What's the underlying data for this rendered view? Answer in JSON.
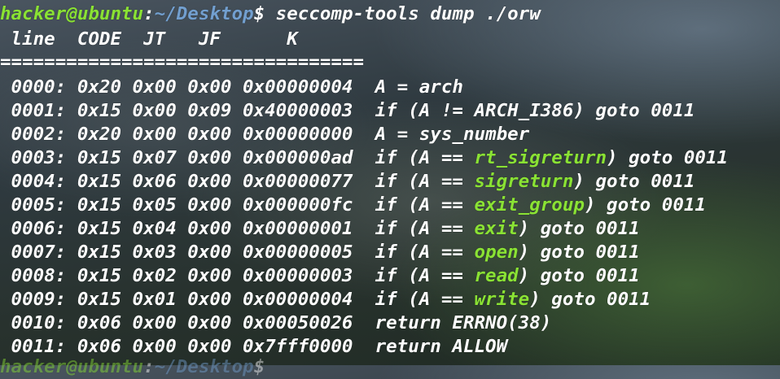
{
  "prompt": {
    "user_host": "hacker@ubuntu",
    "colon": ":",
    "path": "~/Desktop",
    "dollar": "$",
    "command": " seccomp-tools dump ./orw"
  },
  "header": {
    "columns": " line  CODE  JT   JF      K",
    "separator": "================================="
  },
  "rows": [
    {
      "prefix": " 0000: 0x20 0x00 0x00 0x00000004  A = arch",
      "syscall": "",
      "suffix": ""
    },
    {
      "prefix": " 0001: 0x15 0x00 0x09 0x40000003  if (A != ARCH_I386) goto 0011",
      "syscall": "",
      "suffix": ""
    },
    {
      "prefix": " 0002: 0x20 0x00 0x00 0x00000000  A = sys_number",
      "syscall": "",
      "suffix": ""
    },
    {
      "prefix": " 0003: 0x15 0x07 0x00 0x000000ad  if (A == ",
      "syscall": "rt_sigreturn",
      "suffix": ") goto 0011"
    },
    {
      "prefix": " 0004: 0x15 0x06 0x00 0x00000077  if (A == ",
      "syscall": "sigreturn",
      "suffix": ") goto 0011"
    },
    {
      "prefix": " 0005: 0x15 0x05 0x00 0x000000fc  if (A == ",
      "syscall": "exit_group",
      "suffix": ") goto 0011"
    },
    {
      "prefix": " 0006: 0x15 0x04 0x00 0x00000001  if (A == ",
      "syscall": "exit",
      "suffix": ") goto 0011"
    },
    {
      "prefix": " 0007: 0x15 0x03 0x00 0x00000005  if (A == ",
      "syscall": "open",
      "suffix": ") goto 0011"
    },
    {
      "prefix": " 0008: 0x15 0x02 0x00 0x00000003  if (A == ",
      "syscall": "read",
      "suffix": ") goto 0011"
    },
    {
      "prefix": " 0009: 0x15 0x01 0x00 0x00000004  if (A == ",
      "syscall": "write",
      "suffix": ") goto 0011"
    },
    {
      "prefix": " 0010: 0x06 0x00 0x00 0x00050026  return ERRNO(38)",
      "syscall": "",
      "suffix": ""
    },
    {
      "prefix": " 0011: 0x06 0x00 0x00 0x7fff0000  return ALLOW",
      "syscall": "",
      "suffix": ""
    }
  ],
  "next_prompt": {
    "user_host": "hacker@ubuntu",
    "colon": ":",
    "path": "~/Desktop",
    "dollar": "$"
  },
  "colors": {
    "prompt_green": "#8ae234",
    "path_blue": "#729fcf",
    "text": "#ffffff"
  }
}
